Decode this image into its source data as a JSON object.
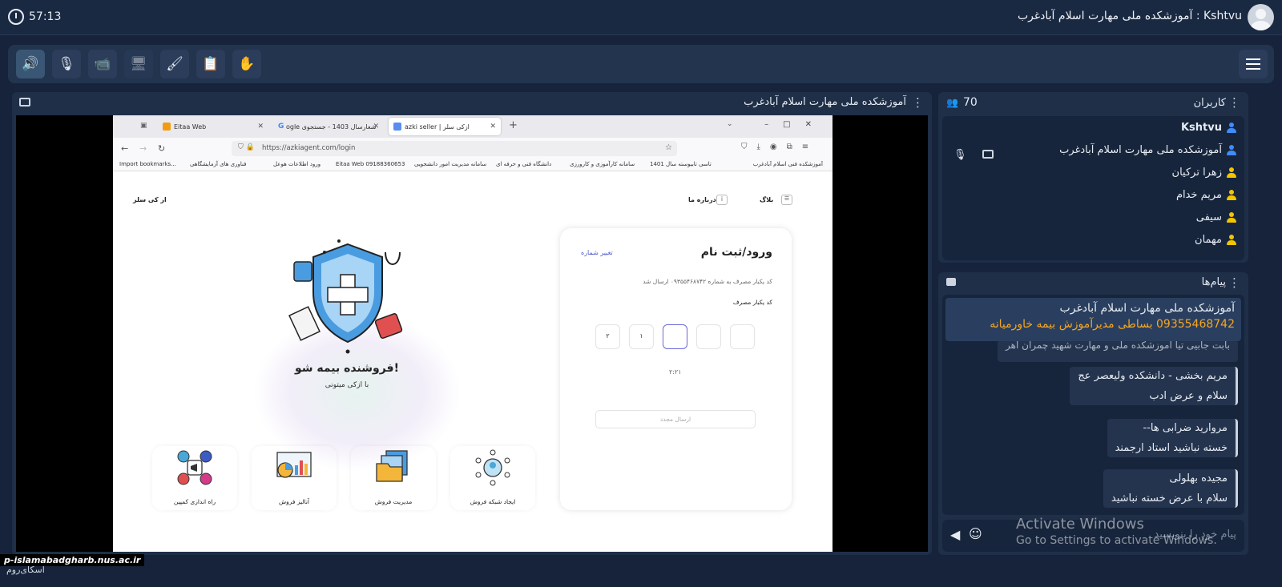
{
  "timer": "57:13",
  "room_title": "Kshtvu : آموزشکده ملی مهارت اسلام آبادغرب",
  "toolbar": {
    "items": [
      {
        "name": "speaker-button",
        "icon": "🔊"
      },
      {
        "name": "mic-off-button",
        "icon": "🎙"
      },
      {
        "name": "camera-off-button",
        "icon": "📹"
      },
      {
        "name": "share-screen-button",
        "icon": "🖥"
      },
      {
        "name": "whiteboard-button",
        "icon": "🖌"
      },
      {
        "name": "files-button",
        "icon": "📋"
      },
      {
        "name": "raise-hand-button",
        "icon": "✋"
      }
    ],
    "accent": "#3fb2ff"
  },
  "stage": {
    "title": "آموزشکده ملی مهارت اسلام آبادغرب"
  },
  "browser": {
    "tabs": [
      {
        "label": "Eitaa Web"
      },
      {
        "label": "شعارسال 1403 - جستجوی Google"
      },
      {
        "label": "ازکی سلر | azki seller"
      }
    ],
    "url": "https://azkiagent.com/login",
    "bookmarks": [
      "Import bookmarks...",
      "فناوری های آزمایشگاهی",
      "ورود اطلاعات هوعل",
      "Eitaa Web 09188360653",
      "سامانه مدیریت امور دانشجویی",
      "دانشگاه فنی و حرفه ای",
      "سامانه کارآموزی و کارورزی",
      "تاسی تابیوسته سال 1401",
      "آموزشکده فنی اسلام آبادغرب"
    ],
    "nav": {
      "blog": "بلاگ",
      "about": "درباره ما",
      "brand": "از کی سلر"
    },
    "login": {
      "title": "ورود/ثبت نام",
      "change_number": "تغییر شماره",
      "sent_message": "کد یکبار مصرف به شماره ۰۹۳۵۵۴۶۸۷۴۲ ارسال شد",
      "otp_label": "کد یکبار مصرف",
      "otp_digits": [
        "",
        "",
        "",
        "۱",
        "۲"
      ],
      "countdown": "۲:۲۱",
      "resend": "ارسال مجدد"
    },
    "hero": {
      "title": "فروشنده بیمه شو!",
      "subtitle": "با ازکی میتونی"
    },
    "features": [
      {
        "label": "ایجاد شبکه فروش"
      },
      {
        "label": "مدیریت فروش"
      },
      {
        "label": "آنالیز فروش"
      },
      {
        "label": "راه اندازی کمپین"
      }
    ]
  },
  "users": {
    "title": "کاربران",
    "count": "70",
    "list": [
      {
        "name": "Kshtvu",
        "color": "#3f8cff"
      },
      {
        "name": "آموزشکده ملی مهارت اسلام آبادغرب",
        "color": "#3f8cff"
      },
      {
        "name": "زهرا ترکیان",
        "color": "#f2c500"
      },
      {
        "name": "مریم خدام",
        "color": "#f2c500"
      },
      {
        "name": "سیفی",
        "color": "#f2c500"
      },
      {
        "name": "مهمان",
        "color": "#f2c500"
      }
    ]
  },
  "messages": {
    "title": "پیام‌ها",
    "pinned": {
      "sender": "آموزشکده ملی مهارت اسلام آبادغرب",
      "text": "09355468742 بساطی مدیرآموزش بیمه خاورمیانه",
      "text_color": "#f5a623"
    },
    "partial": "بابت جابیی تیا آموزشکده ملی و مهارت شهید چمران اهر",
    "items": [
      {
        "sender": "مریم بخشی - دانشکده ولیعصر عج",
        "text": "سلام و عرض ادب"
      },
      {
        "sender": "مروارید ضرابی ها--",
        "text": "خسته نباشید استاد ارجمند"
      },
      {
        "sender": "مجیده بهلولی",
        "text": "سلام با عرض خسته نباشید"
      }
    ],
    "input_placeholder": "پیام خود را بنویسید"
  },
  "watermark": {
    "line1": "Activate Windows",
    "line2": "Go to Settings to activate Windows."
  },
  "footer": {
    "domain": "p-islamabadgharb.nus.ac.ir",
    "brand": "اسکای‌روم"
  }
}
